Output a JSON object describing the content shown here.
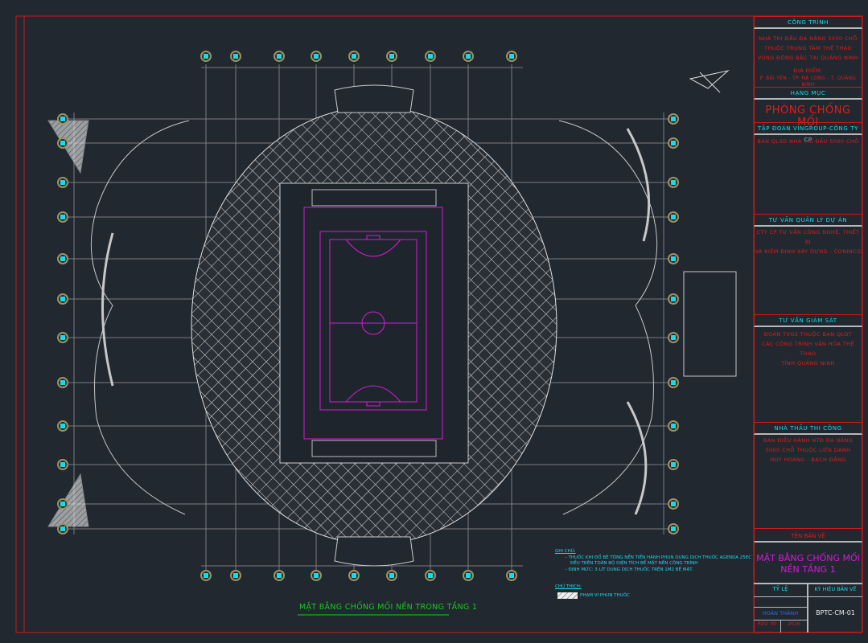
{
  "drawing": {
    "title": "MẶT BẰNG CHỐNG MỐI NỀN TRONG TẦNG 1",
    "notes_heading": "GHI CHÚ:",
    "notes": [
      "– THUỐC KHI ĐỔ BÊ TÔNG NỀN TIẾN HÀNH PHUN DUNG DỊCH THUỐC AGENDA 25EC",
      "ĐỀU TRÊN TOÀN BỘ DIỆN TÍCH BỀ MẶT NỀN CÔNG TRÌNH",
      "– ĐỊNH MỨC: 3 LÍT DUNG DỊCH THUỐC TRÊN 1M2 BỀ MẶT."
    ],
    "legend_heading": "CHÚ THÍCH:",
    "legend_item": "PHẠM VI PHUN THUỐC"
  },
  "title_block": {
    "project_header": "CÔNG TRÌNH",
    "project_lines": [
      "NHÀ THI ĐẤU ĐA NĂNG 5000 CHỖ",
      "THUỘC TRUNG TÂM THỂ THAO",
      "VÙNG ĐÔNG BẮC TẠI QUẢNG NINH"
    ],
    "location": "ĐỊA ĐIỂM:",
    "location_value": "P. BÃI YÊN - TP. HẠ LONG - T. QUẢNG NINH",
    "category_header": "HẠNG MỤC",
    "category": "PHÒNG CHỐNG MỐI",
    "owner_header": "TẬP ĐOÀN VINGROUP-CÔNG TY CP",
    "owner": "BAN QLXD NHÀ THI ĐẤU 5000 CHỖ",
    "pm_header": "TƯ VẤN QUẢN LÝ DỰ ÁN",
    "pm_lines": [
      "CTY CP TƯ VẤN CÔNG NGHỆ, THIẾT BỊ",
      "VÀ KIỂM ĐỊNH XÂY DỰNG - CONINCO"
    ],
    "supervision_header": "TƯ VẤN GIÁM SÁT",
    "supervision_lines": [
      "ĐOÀN TVGS THUỘC BAN QLDT",
      "CÁC CÔNG TRÌNH VĂN HÓA THỂ THAO",
      "TỈNH QUẢNG NINH"
    ],
    "contractor_header": "NHÀ THẦU THI CÔNG",
    "contractor_lines": [
      "BAN ĐIỀU HÀNH NTĐ ĐA NĂNG",
      "5000 CHỖ THUỘC LIÊN DANH",
      "HUY HOÀNG - BẠCH ĐẰNG"
    ],
    "sheet_name_header": "TÊN BẢN VẼ",
    "sheet_name_lines": [
      "MẶT BẰNG CHỐNG MỐI",
      "NỀN TẦNG 1"
    ],
    "scale_label": "TỶ LỆ",
    "sheet_code_label": "KÝ HIỆU BẢN VẼ",
    "status": "HOÀN THÀNH",
    "rev": "REV: 00",
    "year": "2016",
    "sheet_code": "BPTC-CM-01"
  },
  "colors": {
    "background": "#212830",
    "frame": "#d01818",
    "grid": "#7a7d80",
    "hatch": "#d8d8d8",
    "court": "#d51bd8",
    "annotation": "#1fd8e6",
    "title": "#19c81e",
    "bubble": "#9c9460"
  }
}
